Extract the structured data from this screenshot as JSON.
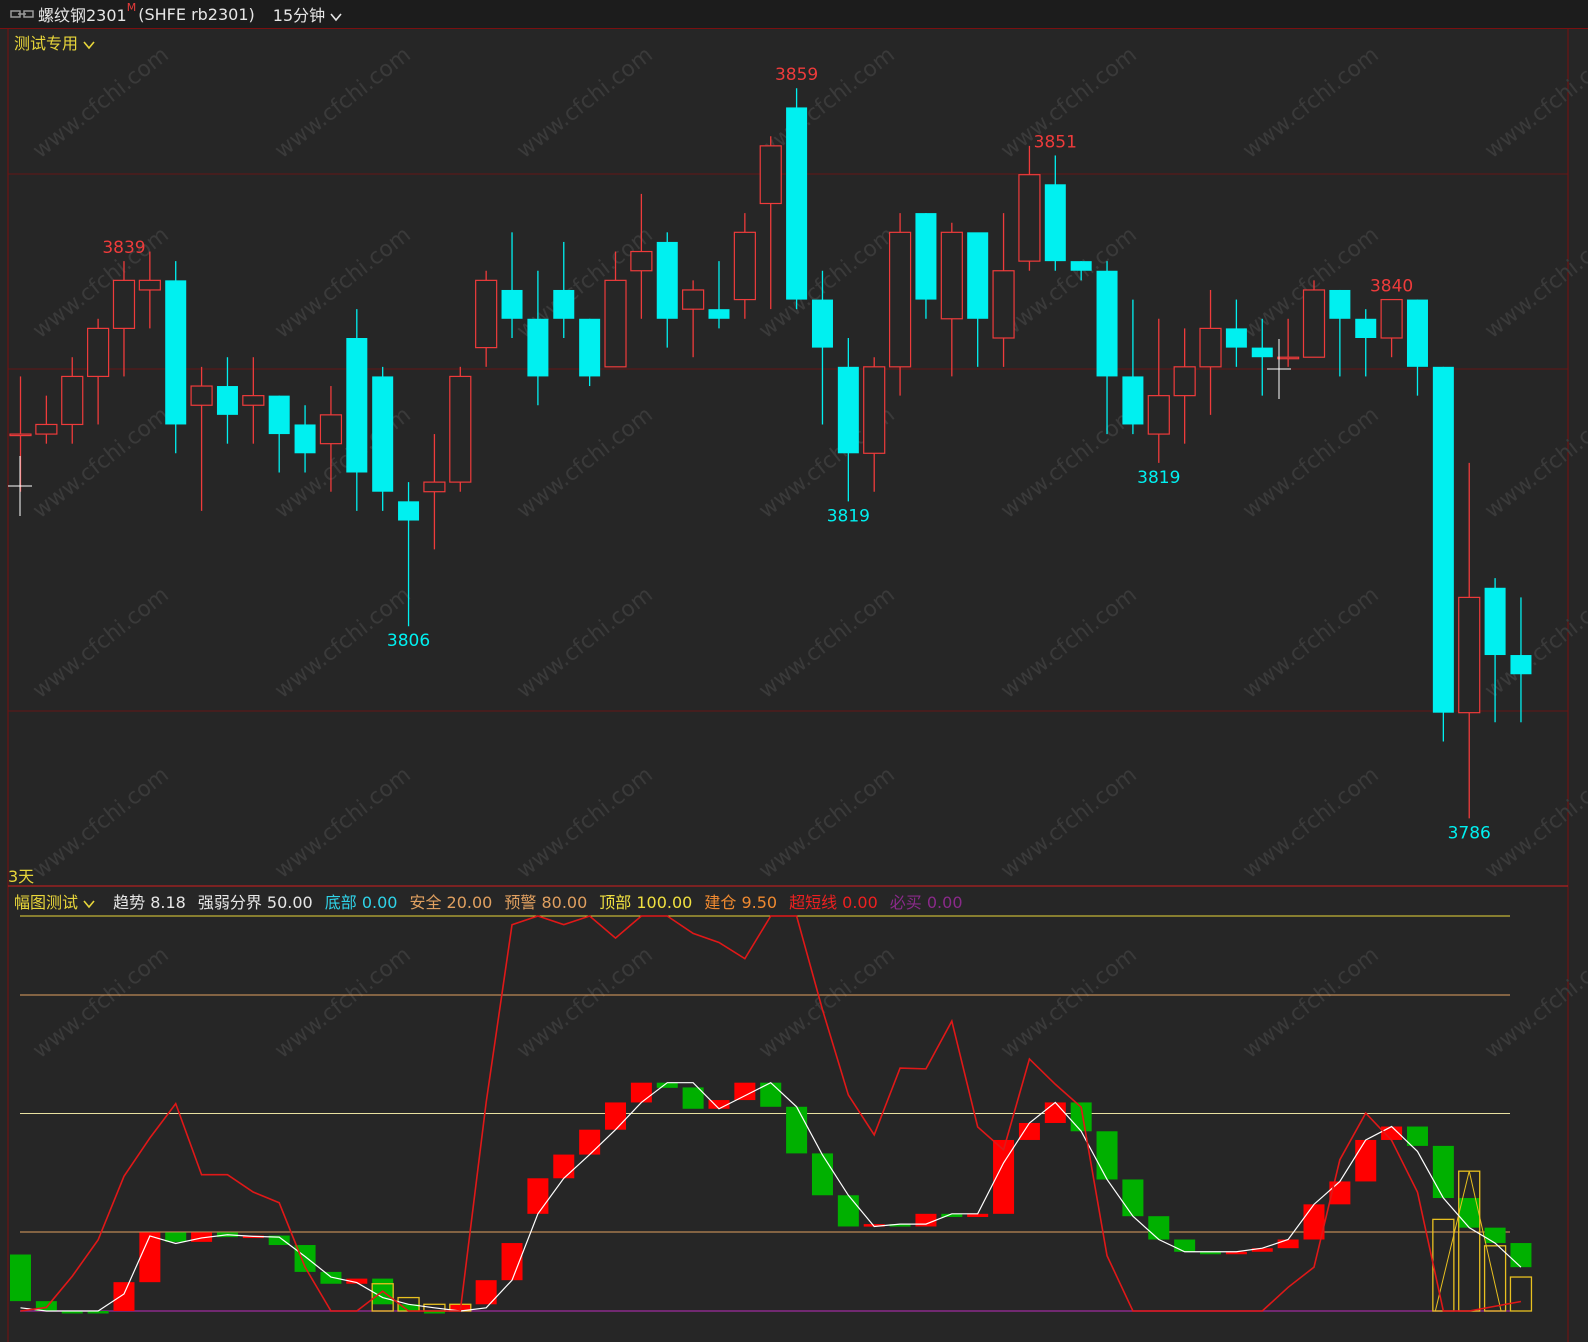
{
  "window": {
    "title": "螺纹钢2301",
    "title_marker": "M",
    "subtitle": "(SHFE rb2301)",
    "period": "15分钟"
  },
  "main_panel": {
    "indicator_name": "测试专用",
    "range_label": "3天"
  },
  "sub_panel": {
    "indicator_name": "幅图测试",
    "readouts": [
      {
        "label": "趋势",
        "value": "8.18",
        "color": "#e6e6e6"
      },
      {
        "label": "强弱分界",
        "value": "50.00",
        "color": "#e6e6e6"
      },
      {
        "label": "底部",
        "value": "0.00",
        "color": "#2fd3e8"
      },
      {
        "label": "安全",
        "value": "20.00",
        "color": "#e0a060"
      },
      {
        "label": "预警",
        "value": "80.00",
        "color": "#e0a060"
      },
      {
        "label": "顶部",
        "value": "100.00",
        "color": "#f0e040"
      },
      {
        "label": "建仓",
        "value": "9.50",
        "color": "#f08a30"
      },
      {
        "label": "超短线",
        "value": "0.00",
        "color": "#ee2020"
      },
      {
        "label": "必买",
        "value": "0.00",
        "color": "#8a2a8a"
      }
    ]
  },
  "colors": {
    "up": "#ee3b3b",
    "down": "#00f0f0",
    "background": "#262626",
    "grid": "#7a1010",
    "bar_red": "#ff0000",
    "bar_green": "#00b000"
  },
  "chart_data": [
    {
      "type": "candlestick",
      "price_range": [
        3780,
        3864
      ],
      "annotations": [
        {
          "text": "3839",
          "index": 4,
          "at": "high",
          "kind": "peak"
        },
        {
          "text": "3806",
          "index": 15,
          "at": "low",
          "kind": "trough"
        },
        {
          "text": "3859",
          "index": 30,
          "at": "high",
          "kind": "peak"
        },
        {
          "text": "3819",
          "index": 32,
          "at": "low",
          "kind": "trough"
        },
        {
          "text": "3851",
          "index": 40,
          "at": "high",
          "kind": "peak"
        },
        {
          "text": "3819",
          "index": 44,
          "at": "low",
          "kind": "trough"
        },
        {
          "text": "3840",
          "index": 53,
          "at": "high",
          "kind": "peak"
        },
        {
          "text": "3786",
          "index": 56,
          "at": "low",
          "kind": "trough"
        }
      ],
      "candles": [
        [
          3826,
          3826,
          3832,
          3820
        ],
        [
          3826,
          3827,
          3830,
          3825
        ],
        [
          3827,
          3832,
          3834,
          3825
        ],
        [
          3832,
          3837,
          3838,
          3827
        ],
        [
          3837,
          3842,
          3844,
          3832
        ],
        [
          3841,
          3842,
          3845,
          3837
        ],
        [
          3842,
          3827,
          3844,
          3824
        ],
        [
          3829,
          3831,
          3833,
          3818
        ],
        [
          3831,
          3828,
          3834,
          3825
        ],
        [
          3829,
          3830,
          3834,
          3825
        ],
        [
          3830,
          3826,
          3830,
          3822
        ],
        [
          3827,
          3824,
          3829,
          3822
        ],
        [
          3825,
          3828,
          3831,
          3820
        ],
        [
          3836,
          3822,
          3839,
          3818
        ],
        [
          3832,
          3820,
          3833,
          3818
        ],
        [
          3819,
          3817,
          3821,
          3806
        ],
        [
          3820,
          3821,
          3826,
          3814
        ],
        [
          3821,
          3832,
          3833,
          3820
        ],
        [
          3835,
          3842,
          3843,
          3833
        ],
        [
          3841,
          3838,
          3847,
          3836
        ],
        [
          3838,
          3832,
          3843,
          3829
        ],
        [
          3841,
          3838,
          3846,
          3836
        ],
        [
          3838,
          3832,
          3838,
          3831
        ],
        [
          3833,
          3842,
          3845,
          3833
        ],
        [
          3843,
          3845,
          3851,
          3838
        ],
        [
          3846,
          3838,
          3847,
          3835
        ],
        [
          3839,
          3841,
          3842,
          3834
        ],
        [
          3839,
          3838,
          3844,
          3837
        ],
        [
          3840,
          3847,
          3849,
          3838
        ],
        [
          3850,
          3856,
          3857,
          3839
        ],
        [
          3860,
          3840,
          3862,
          3839
        ],
        [
          3840,
          3835,
          3843,
          3827
        ],
        [
          3833,
          3824,
          3836,
          3819
        ],
        [
          3824,
          3833,
          3834,
          3820
        ],
        [
          3833,
          3847,
          3849,
          3830
        ],
        [
          3849,
          3840,
          3849,
          3838
        ],
        [
          3838,
          3847,
          3848,
          3832
        ],
        [
          3847,
          3838,
          3846,
          3833
        ],
        [
          3836,
          3843,
          3849,
          3833
        ],
        [
          3844,
          3853,
          3856,
          3843
        ],
        [
          3852,
          3844,
          3855,
          3843
        ],
        [
          3844,
          3843,
          3844,
          3842
        ],
        [
          3843,
          3832,
          3844,
          3826
        ],
        [
          3832,
          3827,
          3840,
          3826
        ],
        [
          3826,
          3830,
          3838,
          3823
        ],
        [
          3830,
          3833,
          3837,
          3825
        ],
        [
          3833,
          3837,
          3841,
          3828
        ],
        [
          3837,
          3835,
          3840,
          3833
        ],
        [
          3835,
          3834,
          3838,
          3830
        ],
        [
          3834,
          3834,
          3838,
          3833
        ],
        [
          3834,
          3841,
          3842,
          3834
        ],
        [
          3841,
          3838,
          3841,
          3832
        ],
        [
          3838,
          3836,
          3839,
          3832
        ],
        [
          3836,
          3840,
          3840,
          3834
        ],
        [
          3840,
          3833,
          3840,
          3830
        ],
        [
          3833,
          3797,
          3833,
          3794
        ],
        [
          3797,
          3809,
          3823,
          3786
        ],
        [
          3810,
          3803,
          3811,
          3796
        ],
        [
          3803,
          3801,
          3809,
          3796
        ]
      ]
    },
    {
      "type": "bar",
      "y_range": [
        0,
        103
      ],
      "reference_lines": [
        100,
        80,
        50,
        20
      ],
      "histogram": [
        [
          2.5,
          14.3,
          "green"
        ],
        [
          0,
          2.5,
          "green"
        ],
        [
          0,
          0,
          "green"
        ],
        [
          0,
          0,
          "green"
        ],
        [
          0,
          7.3,
          "red"
        ],
        [
          7.3,
          19.9,
          "red"
        ],
        [
          19.9,
          17.5,
          "green"
        ],
        [
          17.5,
          19.9,
          "red"
        ],
        [
          19.9,
          18.7,
          "green"
        ],
        [
          18.7,
          19.1,
          "red"
        ],
        [
          19.1,
          16.7,
          "green"
        ],
        [
          16.7,
          9.9,
          "green"
        ],
        [
          9.9,
          6.9,
          "green"
        ],
        [
          6.9,
          8.2,
          "red"
        ],
        [
          8.2,
          1.7,
          "green"
        ],
        [
          1.7,
          0,
          "green"
        ],
        [
          0,
          0,
          "green"
        ],
        [
          0,
          1.7,
          "red"
        ],
        [
          1.7,
          7.8,
          "red"
        ],
        [
          7.8,
          17.2,
          "red"
        ],
        [
          24.6,
          33.6,
          "red"
        ],
        [
          33.6,
          39.6,
          "red"
        ],
        [
          39.6,
          45.9,
          "red"
        ],
        [
          45.9,
          52.8,
          "red"
        ],
        [
          52.8,
          57.8,
          "red"
        ],
        [
          57.8,
          56.5,
          "green"
        ],
        [
          56.6,
          51.2,
          "green"
        ],
        [
          51.2,
          53.4,
          "red"
        ],
        [
          53.4,
          57.8,
          "red"
        ],
        [
          57.8,
          51.7,
          "green"
        ],
        [
          51.7,
          39.9,
          "green"
        ],
        [
          39.9,
          29.3,
          "green"
        ],
        [
          29.3,
          21.4,
          "green"
        ],
        [
          21.4,
          22.0,
          "red"
        ],
        [
          22.0,
          21.4,
          "green"
        ],
        [
          21.4,
          24.6,
          "red"
        ],
        [
          24.6,
          23.8,
          "green"
        ],
        [
          23.8,
          24.6,
          "red"
        ],
        [
          24.6,
          43.3,
          "red"
        ],
        [
          43.3,
          47.6,
          "red"
        ],
        [
          47.6,
          52.8,
          "red"
        ],
        [
          52.8,
          45.5,
          "green"
        ],
        [
          45.5,
          33.3,
          "green"
        ],
        [
          33.3,
          24.0,
          "green"
        ],
        [
          24.0,
          18.1,
          "green"
        ],
        [
          18.1,
          15.0,
          "green"
        ],
        [
          15.0,
          15.0,
          "green"
        ],
        [
          15.0,
          15.0,
          "red"
        ],
        [
          15.0,
          15.9,
          "red"
        ],
        [
          15.9,
          18.1,
          "red"
        ],
        [
          18.1,
          27.0,
          "red"
        ],
        [
          27.0,
          32.8,
          "red"
        ],
        [
          32.8,
          43.3,
          "red"
        ],
        [
          43.3,
          46.7,
          "red"
        ],
        [
          46.7,
          41.8,
          "green"
        ],
        [
          41.8,
          28.6,
          "green"
        ],
        [
          28.6,
          21.1,
          "green"
        ],
        [
          21.1,
          17.2,
          "green"
        ],
        [
          17.2,
          11.1,
          "green"
        ]
      ],
      "yellow_boxes": [
        [
          14,
          0,
          6.9
        ],
        [
          15,
          0,
          3.4
        ],
        [
          16,
          0,
          1.7
        ],
        [
          17,
          0,
          1.7
        ],
        [
          55,
          0,
          23.2
        ],
        [
          56,
          0,
          35.4
        ],
        [
          57,
          0,
          16.5
        ],
        [
          58,
          0,
          8.6
        ]
      ],
      "white_line": [
        0.8,
        0,
        0,
        0,
        4.3,
        19.0,
        17.1,
        18.5,
        19.3,
        18.9,
        18.7,
        13.8,
        8.6,
        7.2,
        3.4,
        1.7,
        0.8,
        0,
        0.8,
        7.8,
        24.6,
        33.6,
        39.6,
        45.9,
        52.8,
        57.8,
        57.8,
        51.2,
        54.5,
        57.8,
        51.7,
        39.5,
        29.3,
        21.4,
        22.0,
        22.0,
        24.6,
        24.6,
        37.5,
        47.6,
        52.8,
        45.5,
        33.3,
        24.0,
        18.1,
        15.0,
        15.0,
        15.0,
        15.9,
        18.1,
        27.0,
        32.8,
        43.3,
        46.7,
        40.4,
        28.6,
        21.1,
        17.2,
        11.1
      ],
      "red_line": [
        0,
        0.9,
        8.8,
        18.0,
        34.1,
        43.8,
        52.5,
        34.5,
        34.5,
        30.1,
        27.4,
        11.1,
        0,
        0,
        5.0,
        0,
        0,
        0,
        52.8,
        97.8,
        100,
        97.8,
        100,
        94.4,
        100,
        100,
        95.6,
        93.3,
        89.2,
        100,
        100,
        76.3,
        54.7,
        44.6,
        61.5,
        61.3,
        73.4,
        46.6,
        40.8,
        63.8,
        57.4,
        51.6,
        14.0,
        0,
        0,
        0,
        0,
        0,
        0,
        6.0,
        11.1,
        38.3,
        50.1,
        43.2,
        30.1,
        0,
        0,
        1.2,
        2.4
      ]
    }
  ]
}
